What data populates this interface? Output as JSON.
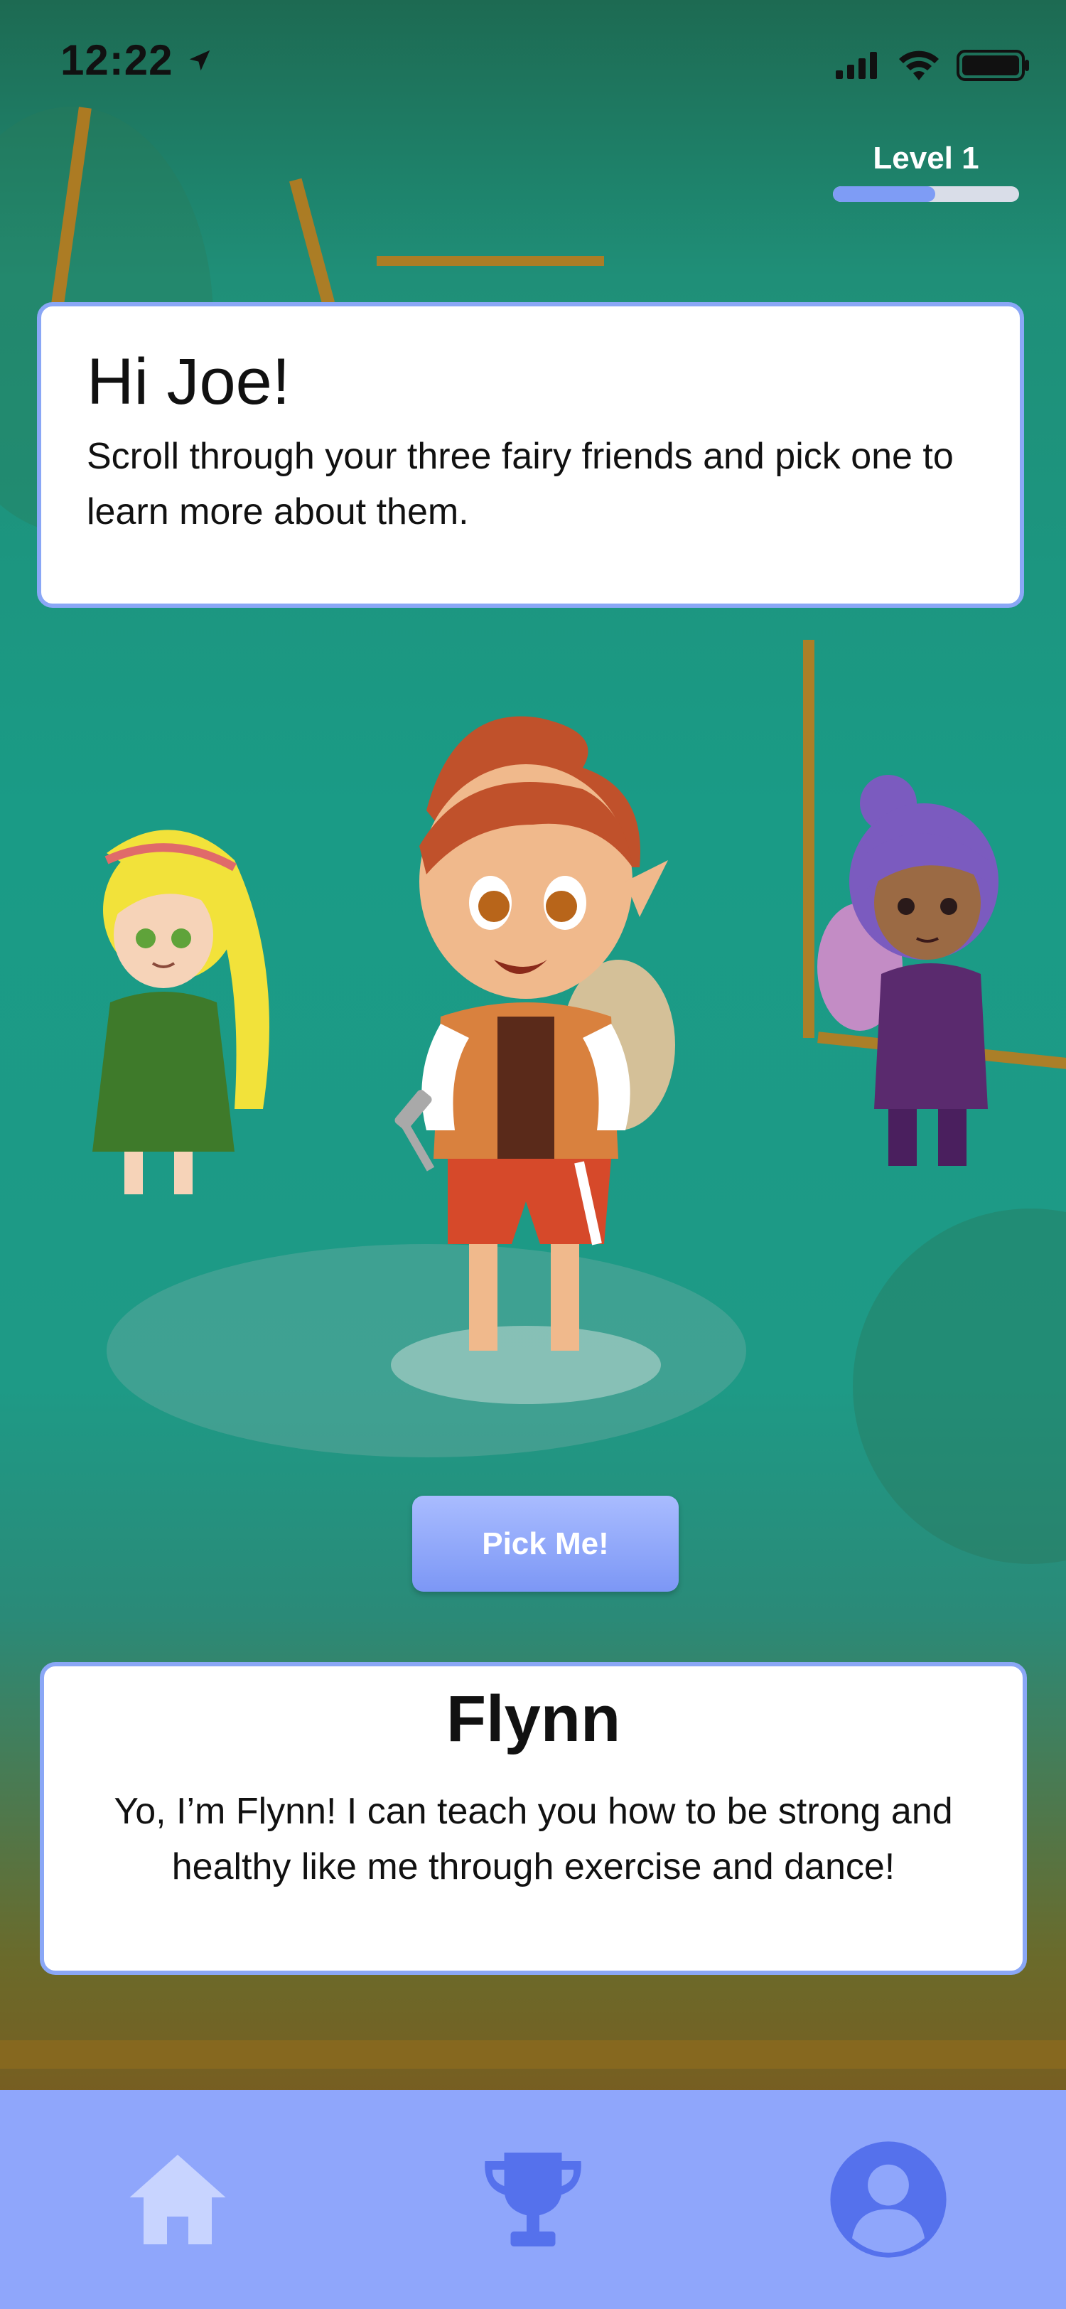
{
  "status_bar": {
    "time": "12:22"
  },
  "level": {
    "label": "Level 1",
    "progress": 0.55
  },
  "greeting": {
    "title": "Hi Joe!",
    "text": "Scroll through your three fairy friends and pick one to learn more about them."
  },
  "pick_button": {
    "label": "Pick Me!"
  },
  "character": {
    "name": "Flynn",
    "description": "Yo, I’m Flynn! I can teach you how to be strong and healthy like me through exercise and dance!"
  },
  "tab_bar": {
    "items": [
      {
        "icon": "home-icon"
      },
      {
        "icon": "trophy-icon"
      },
      {
        "icon": "profile-icon"
      }
    ]
  },
  "colors": {
    "accent": "#8aa7f6",
    "tab_bar": "#8fa6fb",
    "button": "#7c97f5"
  }
}
